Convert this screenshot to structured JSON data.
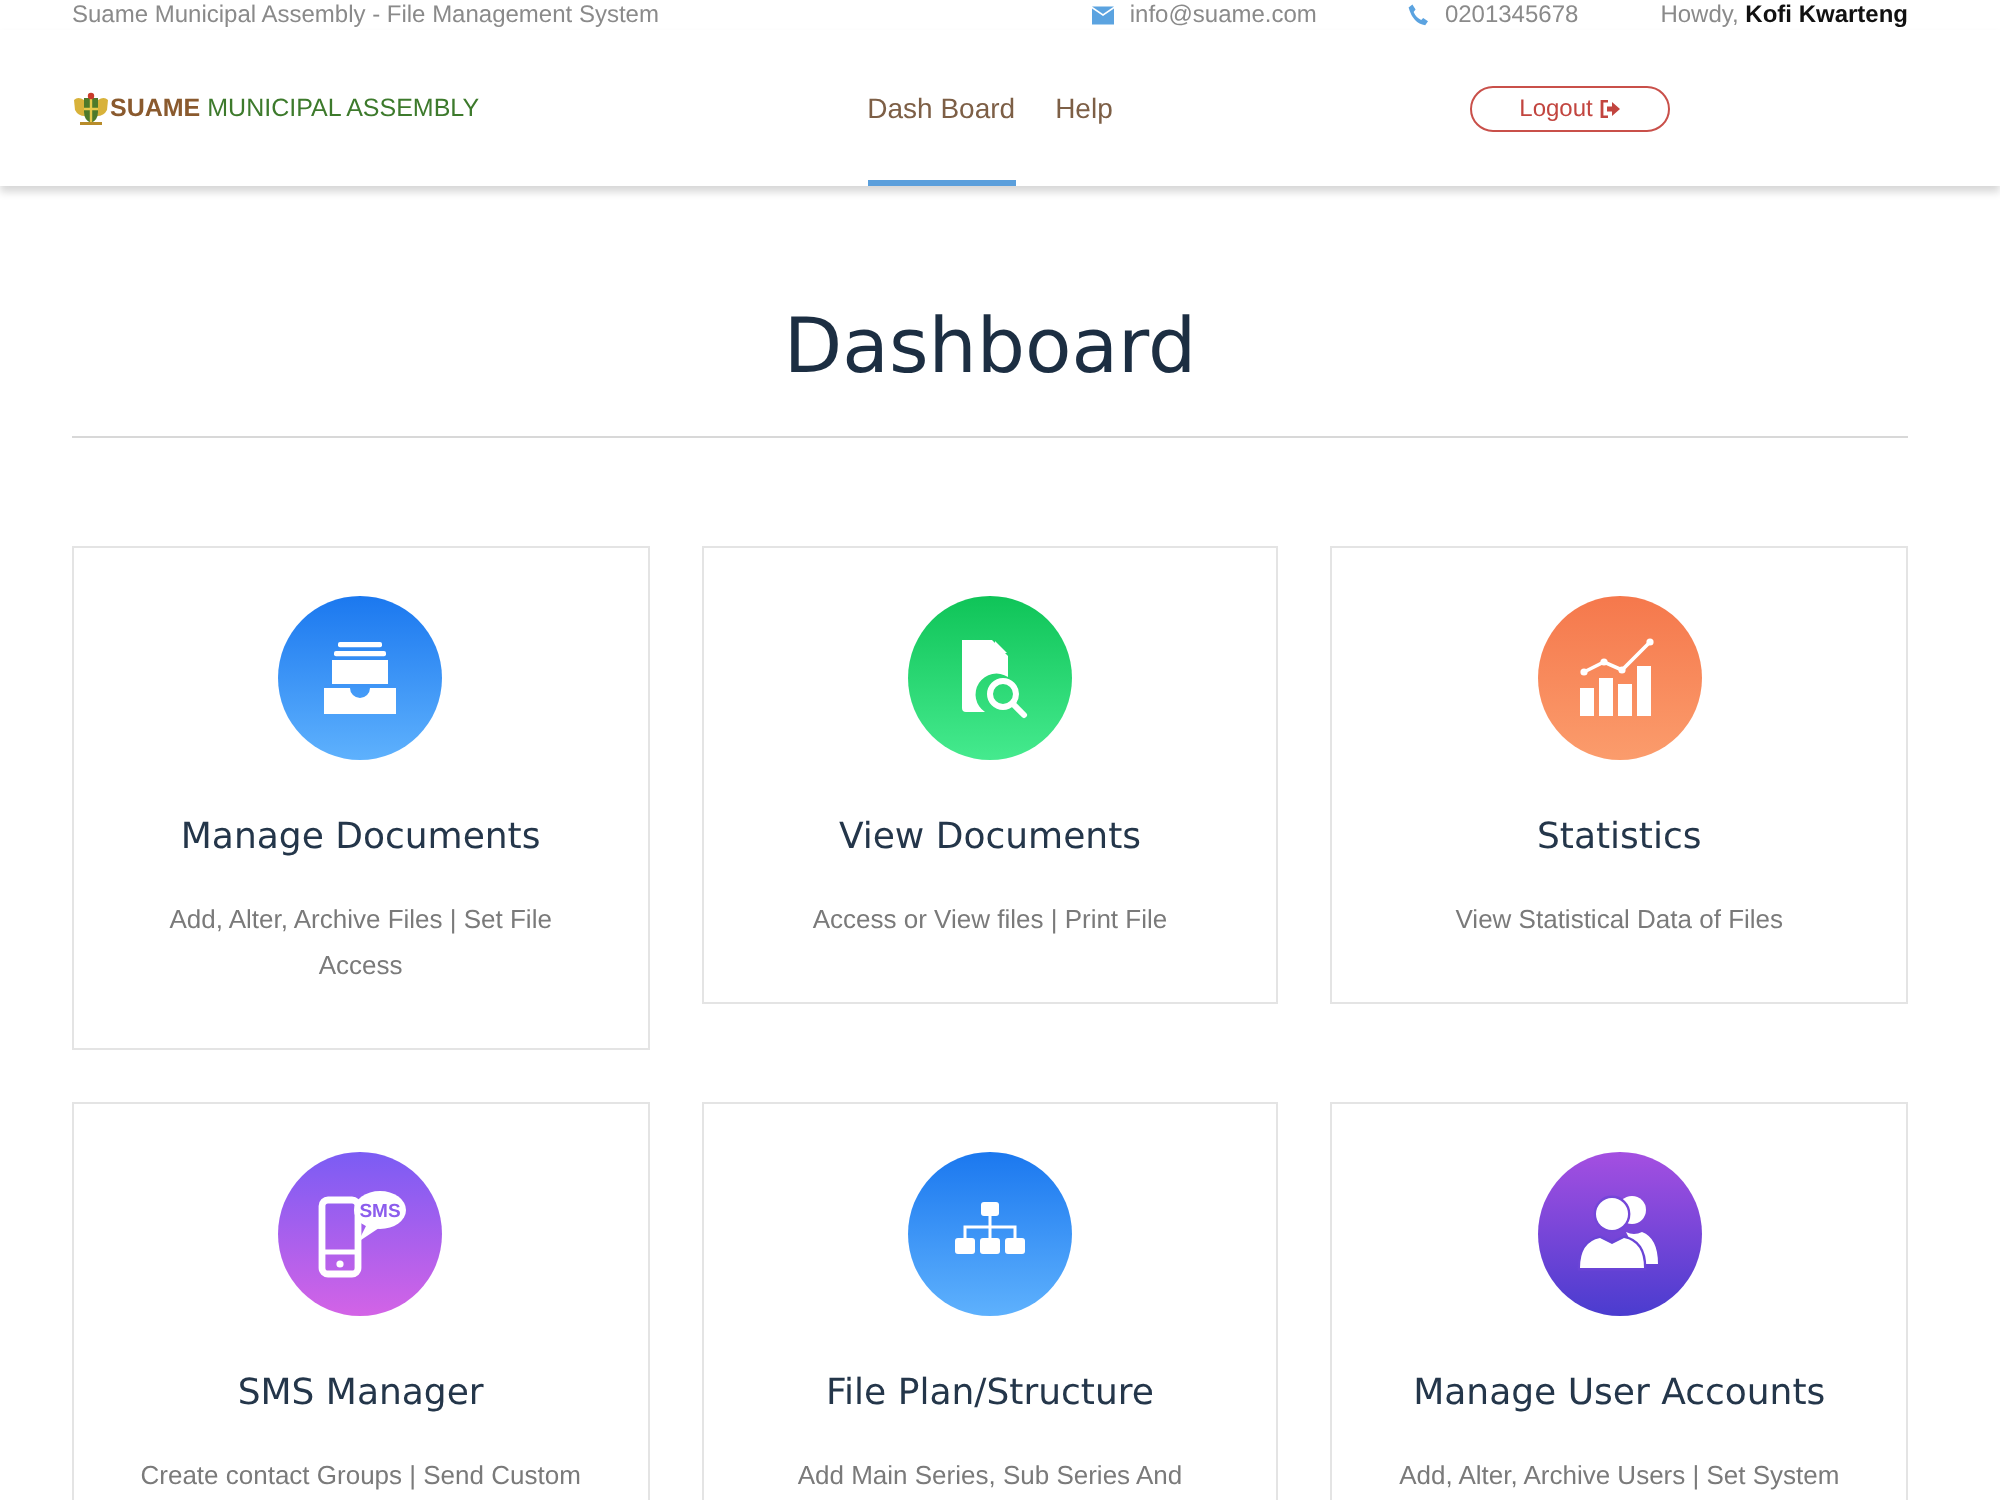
{
  "top_bar": {
    "site_title": "Suame Municipal Assembly - File Management System",
    "email": "info@suame.com",
    "phone": "0201345678",
    "greeting": "Howdy, **Kofi Kwarteng**"
  },
  "navbar": {
    "brand": {
      "highlight": "SUAME",
      "rest": "MUNICIPAL ASSEMBLY"
    },
    "links": [
      {
        "label": "Dash Board",
        "selected": true
      },
      {
        "label": "Help",
        "selected": false
      }
    ],
    "logout": "Logout"
  },
  "page": {
    "title": "Dashboard"
  },
  "cards": [
    {
      "kind": "archive",
      "title": "Manage Documents",
      "description": "Add, Alter, Archive Files | Set File Access"
    },
    {
      "kind": "document-search",
      "title": "View Documents",
      "description": "Access or View files | Print File"
    },
    {
      "kind": "chart",
      "title": "Statistics",
      "description": "View Statistical Data of Files"
    },
    {
      "kind": "sms",
      "icon_text": "SMS",
      "title": "SMS Manager",
      "description": "Create contact Groups | Send Custom"
    },
    {
      "kind": "hierarchy",
      "title": "File Plan/Structure",
      "description": "Add Main Series, Sub Series And"
    },
    {
      "kind": "users",
      "title": "Manage User Accounts",
      "description": "Add, Alter, Archive Users | Set System"
    }
  ]
}
